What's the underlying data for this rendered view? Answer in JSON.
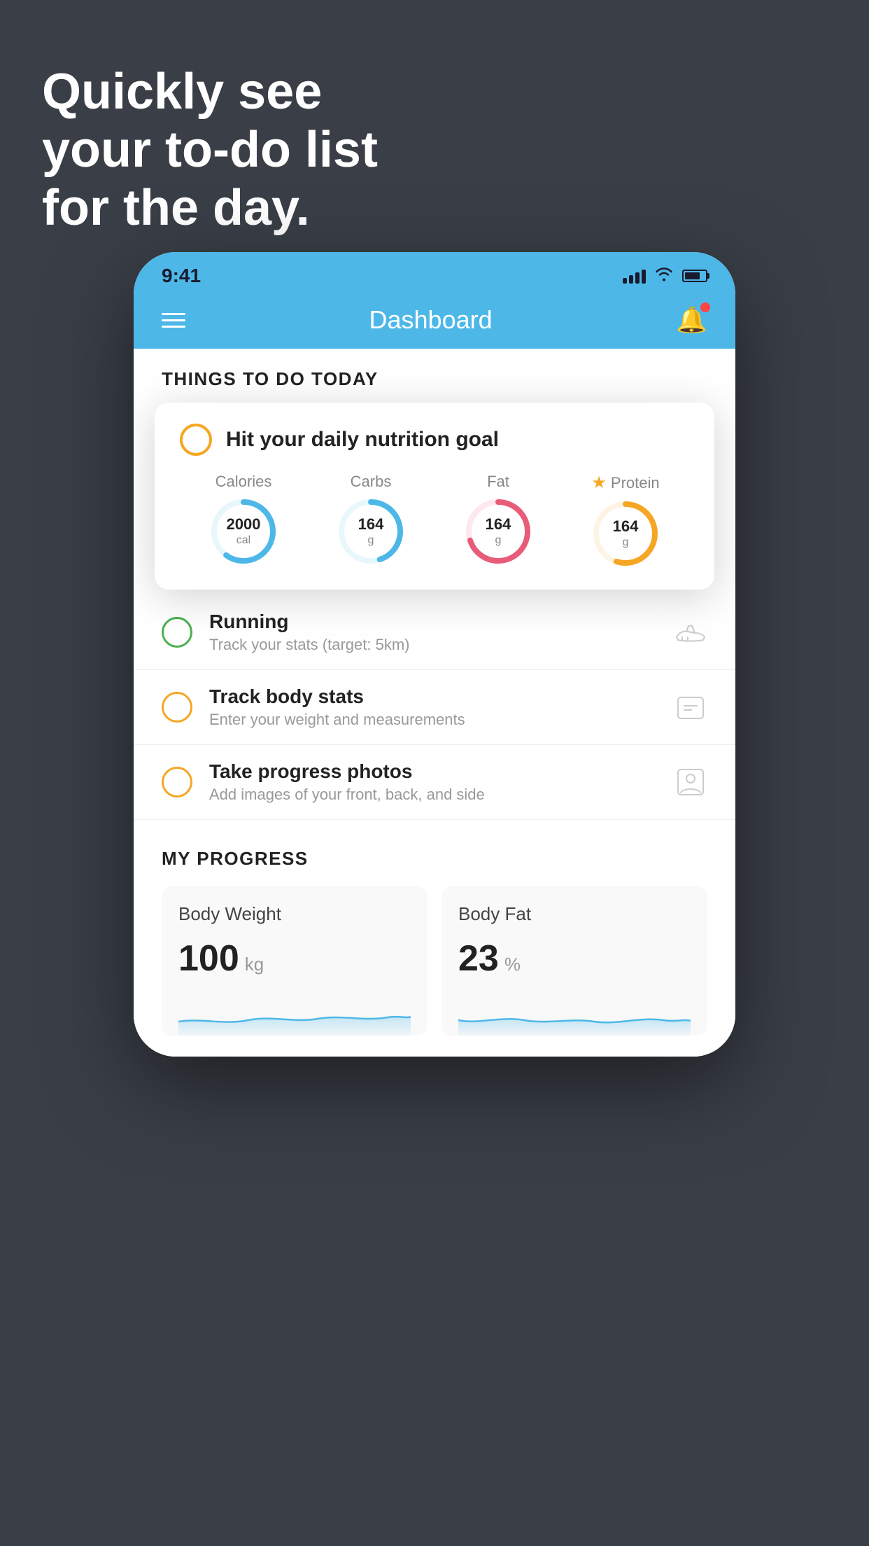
{
  "hero": {
    "line1": "Quickly see",
    "line2": "your to-do list",
    "line3": "for the day."
  },
  "phone": {
    "status_bar": {
      "time": "9:41"
    },
    "nav": {
      "title": "Dashboard"
    },
    "things_section": {
      "title": "THINGS TO DO TODAY"
    },
    "nutrition_card": {
      "check_label": "",
      "title": "Hit your daily nutrition goal",
      "macros": [
        {
          "label": "Calories",
          "value": "2000",
          "unit": "cal",
          "color": "#4db8e8",
          "track_color": "#e8f7fc",
          "percent": 60
        },
        {
          "label": "Carbs",
          "value": "164",
          "unit": "g",
          "color": "#4db8e8",
          "track_color": "#e8f7fc",
          "percent": 45
        },
        {
          "label": "Fat",
          "value": "164",
          "unit": "g",
          "color": "#e85c7a",
          "track_color": "#fce8ed",
          "percent": 70
        },
        {
          "label": "Protein",
          "value": "164",
          "unit": "g",
          "color": "#f5a623",
          "track_color": "#fef4e5",
          "percent": 55,
          "starred": true
        }
      ]
    },
    "todo_items": [
      {
        "circle_color": "green",
        "title": "Running",
        "subtitle": "Track your stats (target: 5km)",
        "icon": "shoe"
      },
      {
        "circle_color": "orange",
        "title": "Track body stats",
        "subtitle": "Enter your weight and measurements",
        "icon": "scale"
      },
      {
        "circle_color": "orange",
        "title": "Take progress photos",
        "subtitle": "Add images of your front, back, and side",
        "icon": "person"
      }
    ],
    "progress_section": {
      "title": "MY PROGRESS",
      "cards": [
        {
          "title": "Body Weight",
          "value": "100",
          "unit": "kg"
        },
        {
          "title": "Body Fat",
          "value": "23",
          "unit": "%"
        }
      ]
    }
  }
}
